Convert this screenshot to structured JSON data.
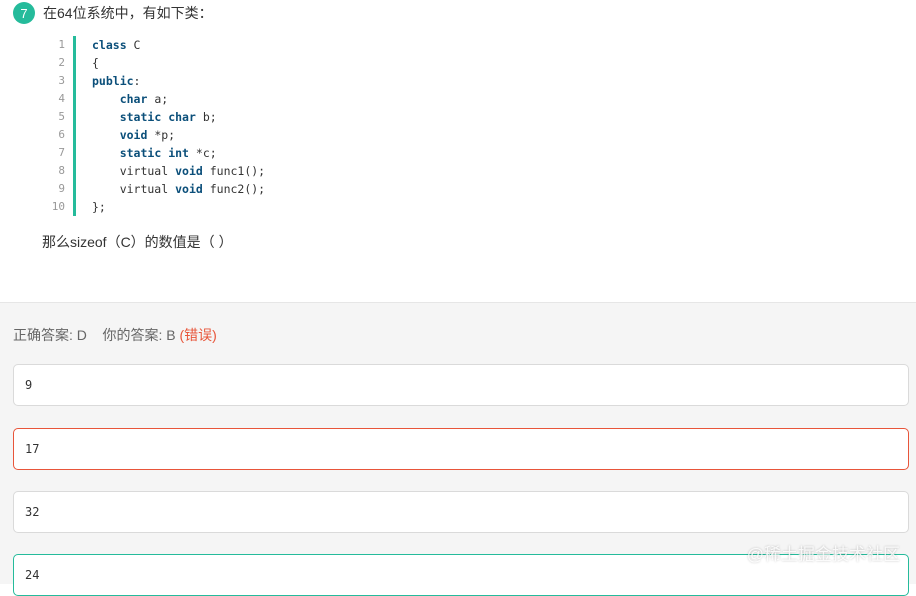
{
  "question": {
    "number": "7",
    "text": "在64位系统中，有如下类：",
    "sub_question": "那么sizeof（C）的数值是（ ）"
  },
  "code": {
    "line_numbers": [
      "1",
      "2",
      "3",
      "4",
      "5",
      "6",
      "7",
      "8",
      "9",
      "10"
    ],
    "lines": [
      [
        {
          "t": "class",
          "kw": true
        },
        {
          "t": " C"
        }
      ],
      [
        {
          "t": "{"
        }
      ],
      [
        {
          "t": "public",
          "kw": true
        },
        {
          "t": ":"
        }
      ],
      [
        {
          "t": "    "
        },
        {
          "t": "char",
          "kw": true
        },
        {
          "t": " a;"
        }
      ],
      [
        {
          "t": "    "
        },
        {
          "t": "static",
          "kw": true
        },
        {
          "t": " "
        },
        {
          "t": "char",
          "kw": true
        },
        {
          "t": " b;"
        }
      ],
      [
        {
          "t": "    "
        },
        {
          "t": "void",
          "kw": true
        },
        {
          "t": " *p;"
        }
      ],
      [
        {
          "t": "    "
        },
        {
          "t": "static",
          "kw": true
        },
        {
          "t": " "
        },
        {
          "t": "int",
          "kw": true
        },
        {
          "t": " *c;"
        }
      ],
      [
        {
          "t": "    virtual "
        },
        {
          "t": "void",
          "kw": true
        },
        {
          "t": " func1();"
        }
      ],
      [
        {
          "t": "    virtual "
        },
        {
          "t": "void",
          "kw": true
        },
        {
          "t": " func2();"
        }
      ],
      [
        {
          "t": "};"
        }
      ]
    ]
  },
  "answer_status": {
    "correct_label": "正确答案: D",
    "your_label": "你的答案: B",
    "verdict": "(错误)"
  },
  "options": [
    {
      "value": "9",
      "state": "normal"
    },
    {
      "value": "17",
      "state": "incorrect"
    },
    {
      "value": "32",
      "state": "normal"
    },
    {
      "value": "24",
      "state": "correct"
    }
  ],
  "colors": {
    "accent": "#25bb9b",
    "wrong": "#e8553a",
    "keyword": "#0b4f7a"
  },
  "watermark": "@稀土掘金技术社区"
}
